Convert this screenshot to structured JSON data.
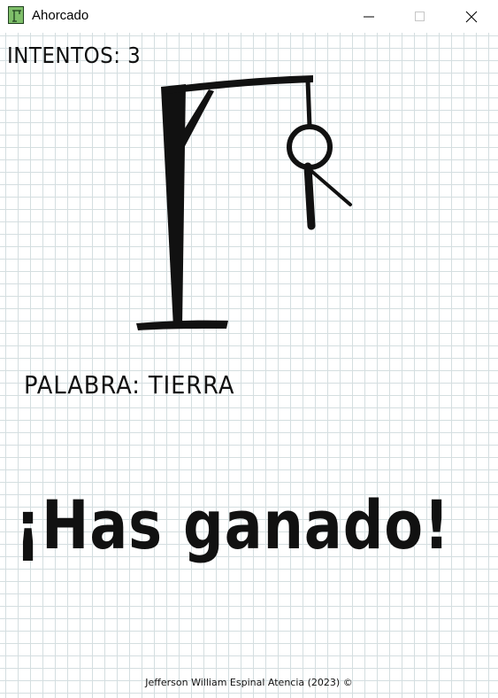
{
  "window": {
    "title": "Ahorcado",
    "controls": {
      "minimize_icon": "minimize-icon",
      "maximize_icon": "maximize-icon",
      "close_icon": "close-icon"
    }
  },
  "game": {
    "attempts_text": "INTENTOS: 3",
    "word_text": "PALABRA: TIERRA",
    "result_text": "¡Has ganado!",
    "credit_text": "Jefferson William Espinal Atencia (2023) ©"
  },
  "colors": {
    "grid_line": "#d4dee0",
    "ink": "#111111",
    "background": "#ffffff",
    "icon_green": "#7fbf6a"
  }
}
